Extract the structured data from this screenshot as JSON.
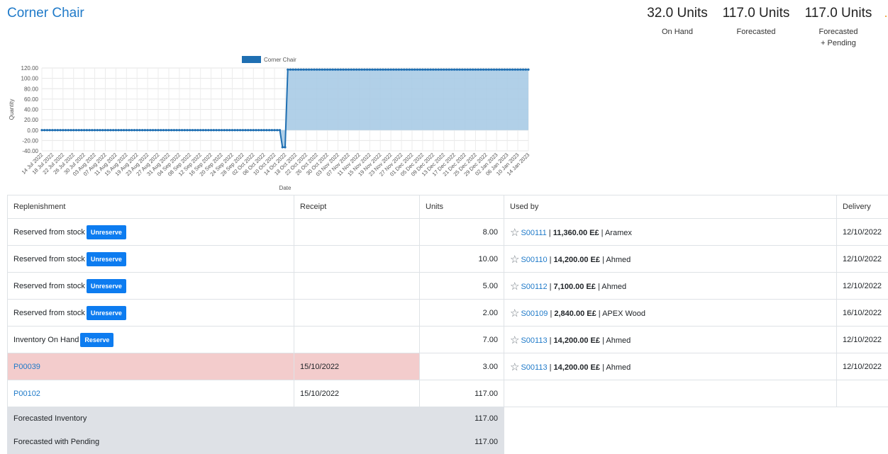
{
  "product": {
    "title": "Corner Chair"
  },
  "kpis": [
    {
      "value": "32.0 Units",
      "label": "On Hand",
      "label2": ""
    },
    {
      "value": "117.0 Units",
      "label": "Forecasted",
      "label2": ""
    },
    {
      "value": "117.0 Units",
      "label": "Forecasted",
      "label2": "+ Pending"
    }
  ],
  "chart_data": {
    "type": "area",
    "legend": "Corner Chair",
    "legend_position": "top",
    "ylabel": "Quantity",
    "xlabel": "Date",
    "ylim": [
      -40,
      120
    ],
    "yticks": [
      "120.00",
      "100.00",
      "80.00",
      "60.00",
      "40.00",
      "20.00",
      "0.00",
      "-20.00",
      "-40.00"
    ],
    "grid": true,
    "color": "#1f6fb2",
    "fill": "#a9cbe5",
    "x_ticks": [
      "14 Jul 2022",
      "18 Jul 2022",
      "22 Jul 2022",
      "26 Jul 2022",
      "30 Jul 2022",
      "03 Aug 2022",
      "07 Aug 2022",
      "11 Aug 2022",
      "15 Aug 2022",
      "19 Aug 2022",
      "23 Aug 2022",
      "27 Aug 2022",
      "31 Aug 2022",
      "04 Sep 2022",
      "08 Sep 2022",
      "12 Sep 2022",
      "16 Sep 2022",
      "20 Sep 2022",
      "24 Sep 2022",
      "28 Sep 2022",
      "02 Oct 2022",
      "06 Oct 2022",
      "10 Oct 2022",
      "14 Oct 2022",
      "18 Oct 2022",
      "22 Oct 2022",
      "26 Oct 2022",
      "30 Oct 2022",
      "03 Nov 2022",
      "07 Nov 2022",
      "11 Nov 2022",
      "15 Nov 2022",
      "19 Nov 2022",
      "23 Nov 2022",
      "27 Nov 2022",
      "01 Dec 2022",
      "05 Dec 2022",
      "09 Dec 2022",
      "13 Dec 2022",
      "17 Dec 2022",
      "21 Dec 2022",
      "25 Dec 2022",
      "29 Dec 2022",
      "02 Jan 2023",
      "06 Jan 2023",
      "10 Jan 2023",
      "14 Jan 2023"
    ],
    "series": [
      {
        "name": "Corner Chair",
        "points": [
          {
            "x": "14 Jul 2022",
            "y": 0
          },
          {
            "x": "12 Oct 2022",
            "y": 0
          },
          {
            "x": "13 Oct 2022",
            "y": -33
          },
          {
            "x": "14 Oct 2022",
            "y": -33
          },
          {
            "x": "15 Oct 2022",
            "y": 117
          },
          {
            "x": "14 Jan 2023",
            "y": 117
          }
        ]
      }
    ]
  },
  "table": {
    "headers": [
      "Replenishment",
      "Receipt",
      "Units",
      "Used by",
      "Delivery"
    ],
    "rows": [
      {
        "replenishment": "Reserved from stock",
        "button": "Unreserve",
        "receipt": "",
        "units": "8.00",
        "order": "S00111",
        "amount": "11,360.00 E£",
        "partner": "Aramex",
        "delivery": "12/10/2022",
        "late": false,
        "link": false
      },
      {
        "replenishment": "Reserved from stock",
        "button": "Unreserve",
        "receipt": "",
        "units": "10.00",
        "order": "S00110",
        "amount": "14,200.00 E£",
        "partner": "Ahmed",
        "delivery": "12/10/2022",
        "late": false,
        "link": false
      },
      {
        "replenishment": "Reserved from stock",
        "button": "Unreserve",
        "receipt": "",
        "units": "5.00",
        "order": "S00112",
        "amount": "7,100.00 E£",
        "partner": "Ahmed",
        "delivery": "12/10/2022",
        "late": false,
        "link": false
      },
      {
        "replenishment": "Reserved from stock",
        "button": "Unreserve",
        "receipt": "",
        "units": "2.00",
        "order": "S00109",
        "amount": "2,840.00 E£",
        "partner": "APEX Wood",
        "delivery": "16/10/2022",
        "late": false,
        "link": false
      },
      {
        "replenishment": "Inventory On Hand",
        "button": "Reserve",
        "receipt": "",
        "units": "7.00",
        "order": "S00113",
        "amount": "14,200.00 E£",
        "partner": "Ahmed",
        "delivery": "12/10/2022",
        "late": false,
        "link": false
      },
      {
        "replenishment": "P00039",
        "button": "",
        "receipt": "15/10/2022",
        "units": "3.00",
        "order": "S00113",
        "amount": "14,200.00 E£",
        "partner": "Ahmed",
        "delivery": "12/10/2022",
        "late": true,
        "link": true
      },
      {
        "replenishment": "P00102",
        "button": "",
        "receipt": "15/10/2022",
        "units": "117.00",
        "order": "",
        "amount": "",
        "partner": "",
        "delivery": "",
        "late": false,
        "link": true
      }
    ],
    "summary": [
      {
        "label": "Forecasted Inventory",
        "value": "117.00"
      },
      {
        "label": "Forecasted with Pending",
        "value": "117.00"
      }
    ]
  }
}
